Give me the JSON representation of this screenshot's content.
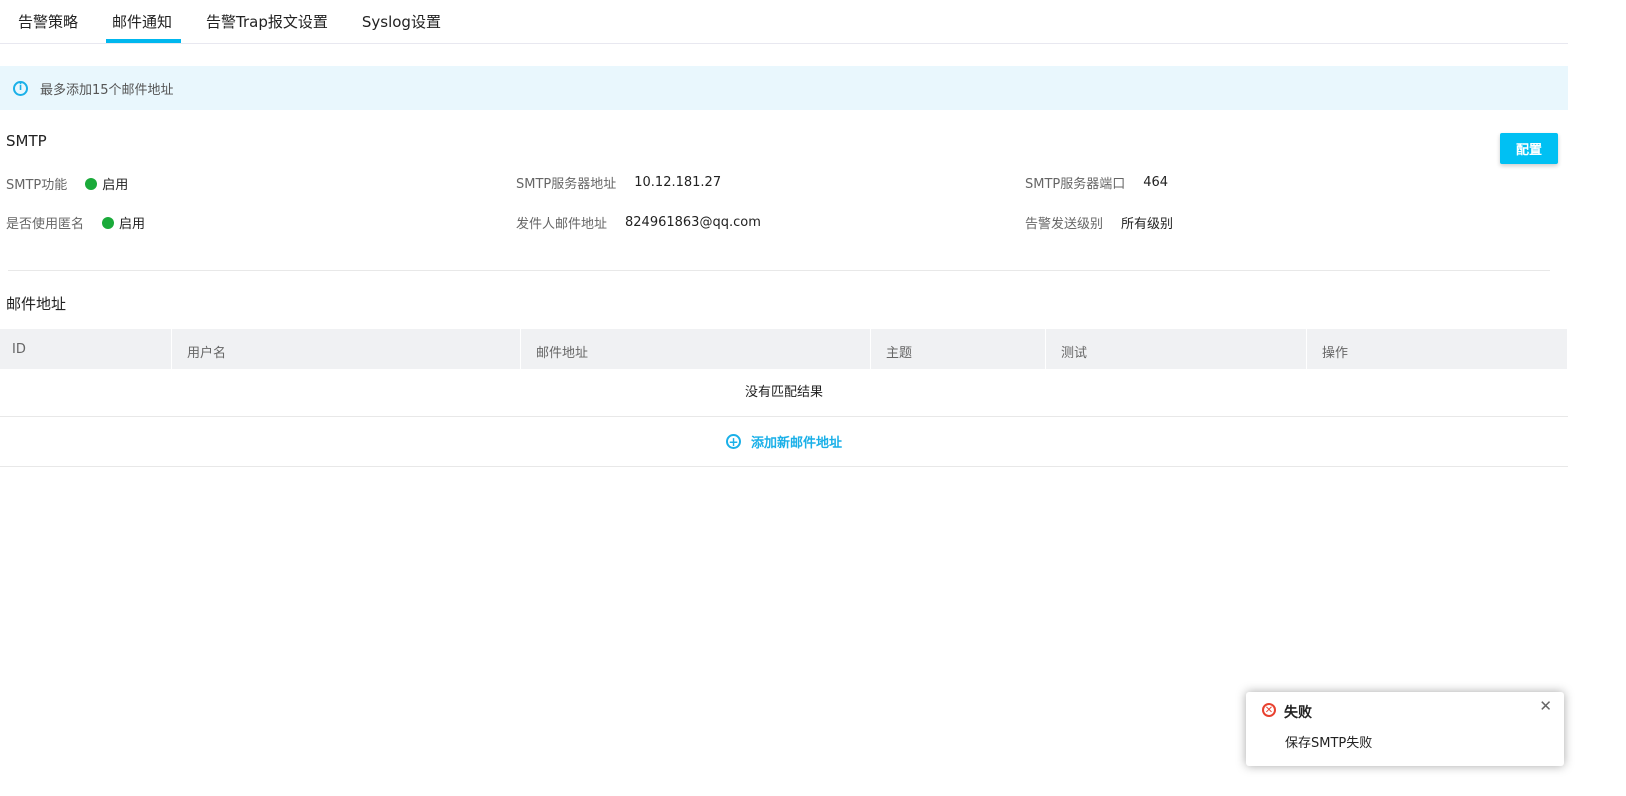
{
  "tabs": [
    "告警策略",
    "邮件通知",
    "告警Trap报文设置",
    "Syslog设置"
  ],
  "alert": "最多添加15个邮件地址",
  "smtp": {
    "title": "SMTP",
    "config_label": "配置",
    "fields": [
      {
        "label": "SMTP功能",
        "value": "启用"
      },
      {
        "label": "是否使用匿名",
        "value": "启用"
      },
      {
        "label": "SMTP服务器地址",
        "value": "10.12.181.27"
      },
      {
        "label": "发件人邮件地址",
        "value": "824961863@qq.com"
      },
      {
        "label": "SMTP服务器端口",
        "value": "464"
      },
      {
        "label": "告警发送级别",
        "value": "所有级别"
      }
    ]
  },
  "mail": {
    "title": "邮件地址",
    "columns": [
      "ID",
      "用户名",
      "邮件地址",
      "主题",
      "测试",
      "操作"
    ],
    "empty": "没有匹配结果",
    "add_label": "添加新邮件地址"
  },
  "toast": {
    "title": "失败",
    "message": "保存SMTP失败"
  },
  "colors": {
    "accent": "#00b7ee",
    "success": "#1aaa3a",
    "error": "#e8412f"
  }
}
